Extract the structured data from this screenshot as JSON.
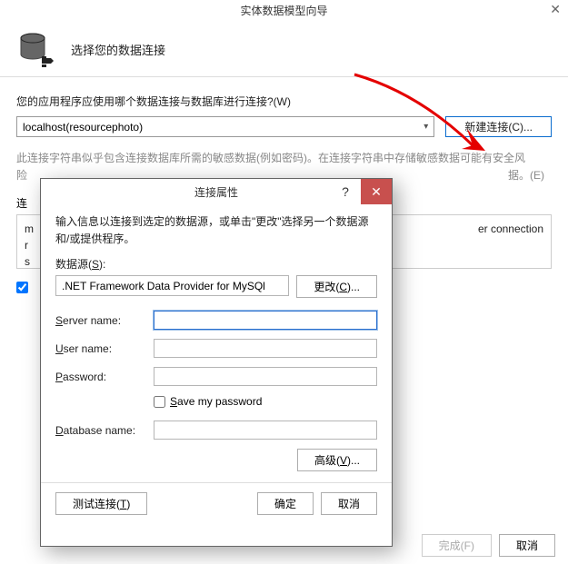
{
  "wizard": {
    "title": "实体数据模型向导",
    "header_title": "选择您的数据连接",
    "question_label": "您的应用程序应使用哪个数据连接与数据库进行连接?(W)",
    "combo_value": "localhost(resourcephoto)",
    "new_conn_btn": "新建连接(C)...",
    "info_line1": "此连接字符串似乎包含连接数据库所需的敏感数据(例如密码)。在连接字符串中存储敏感数据可能有安全风",
    "info_line2": "险",
    "info_suffix": "据。(E)",
    "conn_label_prefix": "连",
    "code_left": "m\nr\ns",
    "code_right": "er connection",
    "save_checked": true,
    "footer_finish": "完成(F)",
    "footer_cancel": "取消"
  },
  "dialog": {
    "title": "连接属性",
    "instruction": "输入信息以连接到选定的数据源，或单击\"更改\"选择另一个数据源和/或提供程序。",
    "ds_label": "数据源(S):",
    "ds_value": ".NET Framework Data Provider for MySQl",
    "change_btn": "更改(C)...",
    "server_label": "Server name:",
    "user_label": "User name:",
    "password_label": "Password:",
    "save_pw_label": "Save my password",
    "database_label": "Database name:",
    "advanced_btn": "高级(V)...",
    "test_btn": "测试连接(T)",
    "ok_btn": "确定",
    "cancel_btn": "取消",
    "server_value": "",
    "user_value": "",
    "password_value": "",
    "database_value": ""
  }
}
